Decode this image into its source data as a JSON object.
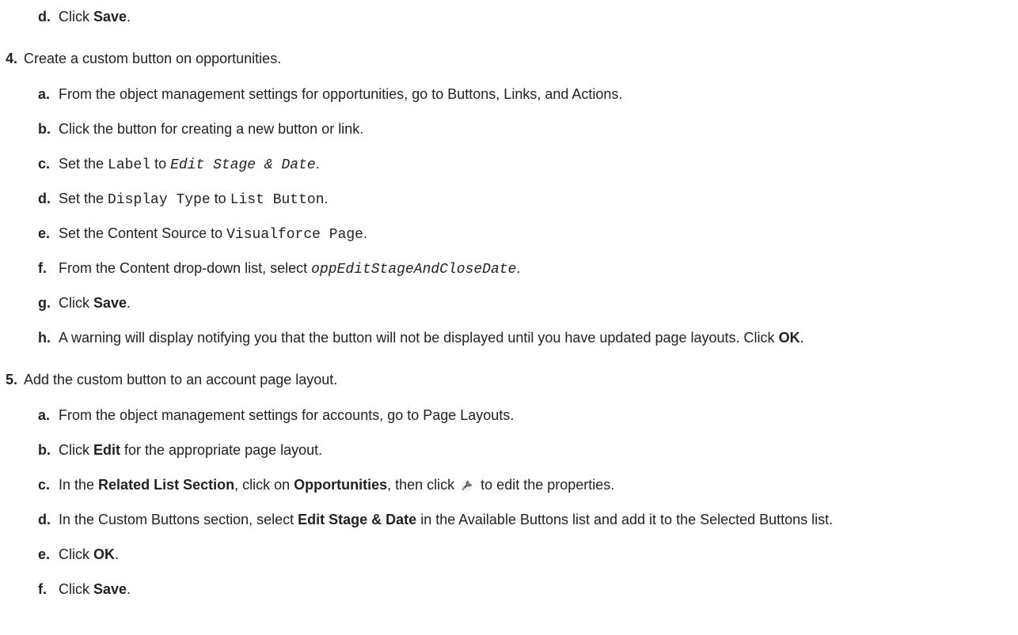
{
  "steps": [
    {
      "marker": "d.",
      "prefix": "Click ",
      "bold": "Save",
      "suffix": "."
    },
    {
      "marker": "4.",
      "text": "Create a custom button on opportunities."
    },
    {
      "marker": "a.",
      "text": "From the object management settings for opportunities, go to Buttons, Links, and Actions."
    },
    {
      "marker": "b.",
      "text": "Click the button for creating a new button or link."
    },
    {
      "marker": "c.",
      "prefix": "Set the ",
      "code": "Label",
      "mid": " to ",
      "code_italic": "Edit Stage & Date",
      "suffix": "."
    },
    {
      "marker": "d.",
      "prefix": "Set the ",
      "code": "Display Type",
      "mid": " to ",
      "code2": "List Button",
      "suffix": "."
    },
    {
      "marker": "e.",
      "prefix": "Set the Content Source to ",
      "code": "Visualforce Page",
      "suffix": "."
    },
    {
      "marker": "f.",
      "prefix": "From the Content drop-down list, select ",
      "code_italic": "oppEditStageAndCloseDate",
      "suffix": "."
    },
    {
      "marker": "g.",
      "prefix": "Click ",
      "bold": "Save",
      "suffix": "."
    },
    {
      "marker": "h.",
      "prefix": "A warning will display notifying you that the button will not be displayed until you have updated page layouts. Click ",
      "bold": "OK",
      "suffix": "."
    },
    {
      "marker": "5.",
      "text": "Add the custom button to an account page layout."
    },
    {
      "marker": "a.",
      "text": "From the object management settings for accounts, go to Page Layouts."
    },
    {
      "marker": "b.",
      "prefix": "Click ",
      "bold": "Edit",
      "suffix": " for the appropriate page layout."
    },
    {
      "marker": "c.",
      "prefix": "In the ",
      "bold": "Related List Section",
      "mid": ", click on ",
      "bold2": "Opportunities",
      "mid2": ", then click ",
      "icon": "wrench-icon",
      "suffix": " to edit the properties."
    },
    {
      "marker": "d.",
      "prefix": "In the Custom Buttons section, select ",
      "bold": "Edit Stage & Date",
      "suffix": " in the Available Buttons list and add it to the Selected Buttons list."
    },
    {
      "marker": "e.",
      "prefix": "Click ",
      "bold": "OK",
      "suffix": "."
    },
    {
      "marker": "f.",
      "prefix": "Click ",
      "bold": "Save",
      "suffix": "."
    }
  ]
}
